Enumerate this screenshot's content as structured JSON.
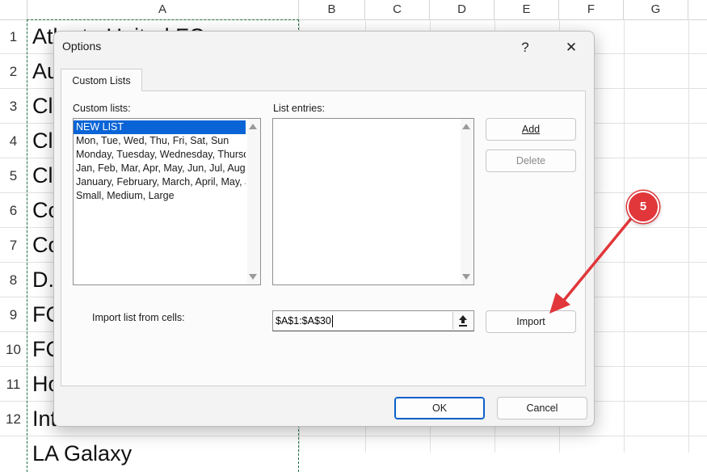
{
  "spreadsheet": {
    "columns": [
      "A",
      "B",
      "C",
      "D",
      "E",
      "F",
      "G"
    ],
    "rows": [
      "1",
      "2",
      "3",
      "4",
      "5",
      "6",
      "7",
      "8",
      "9",
      "10",
      "11",
      "12"
    ],
    "cells": [
      "Atlanta United FC",
      "Au",
      "Cl",
      "Cl",
      "Cl",
      "Co",
      "Co",
      "D.",
      "FC",
      "FC",
      "Ho",
      "Inter Miami CF",
      "LA Galaxy"
    ]
  },
  "dialog": {
    "title": "Options",
    "help_label": "?",
    "close_label": "✕",
    "tab_label": "Custom Lists",
    "custom_lists_label": "Custom lists:",
    "list_entries_label": "List entries:",
    "custom_lists": [
      "NEW LIST",
      "Mon, Tue, Wed, Thu, Fri, Sat, Sun",
      "Monday, Tuesday, Wednesday, Thursday, Friday, Saturday, Sunday",
      "Jan, Feb, Mar, Apr, May, Jun, Jul, Aug, Sep, Oct, Nov, Dec",
      "January, February, March, April, May, June, July, August, September, October, November, December",
      "Small, Medium, Large"
    ],
    "add_label": "Add",
    "delete_label": "Delete",
    "import_from_label": "Import list from cells:",
    "import_range_value": "$A$1:$A$30",
    "import_label": "Import",
    "ok_label": "OK",
    "cancel_label": "Cancel"
  },
  "annotation": {
    "step_number": "5",
    "color": "#e1363a"
  }
}
